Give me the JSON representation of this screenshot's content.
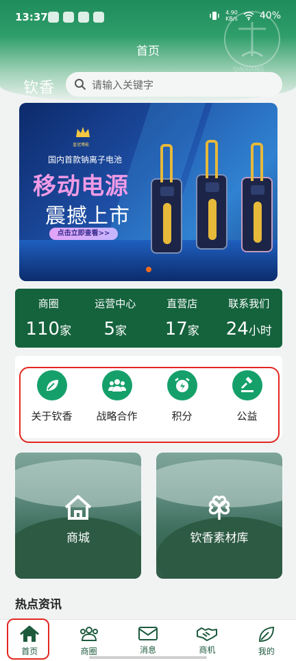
{
  "status_bar": {
    "time": "13:37",
    "net_speed_value": "4.90",
    "net_speed_unit": "KB/s",
    "battery": "40%"
  },
  "header": {
    "watermark_text": "QINXIANG",
    "title": "首页",
    "brand": "钦香",
    "search_placeholder": "请输入关键字"
  },
  "banner": {
    "crown_text": "皇冠博能",
    "subtitle": "国内首款钠离子电池",
    "title_line1": "移动电源",
    "title_line2": "震撼上市",
    "button": "点击立即查看>>"
  },
  "stats": [
    {
      "label": "商圈",
      "value": "110",
      "unit": "家"
    },
    {
      "label": "运营中心",
      "value": "5",
      "unit": "家"
    },
    {
      "label": "直营店",
      "value": "17",
      "unit": "家"
    },
    {
      "label": "联系我们",
      "value": "24",
      "unit": "小时"
    }
  ],
  "grid": [
    {
      "label": "关于钦香",
      "icon": "leaf-icon"
    },
    {
      "label": "战略合作",
      "icon": "group-icon"
    },
    {
      "label": "积分",
      "icon": "alarm-clock-icon"
    },
    {
      "label": "公益",
      "icon": "gavel-icon"
    }
  ],
  "tiles": [
    {
      "label": "商城",
      "icon": "house-icon"
    },
    {
      "label": "钦香素材库",
      "icon": "clover-icon"
    }
  ],
  "news_title": "热点资讯",
  "bottom_nav": [
    {
      "label": "首页",
      "icon": "home-icon"
    },
    {
      "label": "商圈",
      "icon": "handshake-icon"
    },
    {
      "label": "消息",
      "icon": "envelope-icon"
    },
    {
      "label": "商机",
      "icon": "deal-icon"
    },
    {
      "label": "我的",
      "icon": "leaf-icon"
    }
  ],
  "colors": {
    "primary_green": "#15633d",
    "accent_green": "#15a06a",
    "highlight_red": "#e3261f"
  }
}
